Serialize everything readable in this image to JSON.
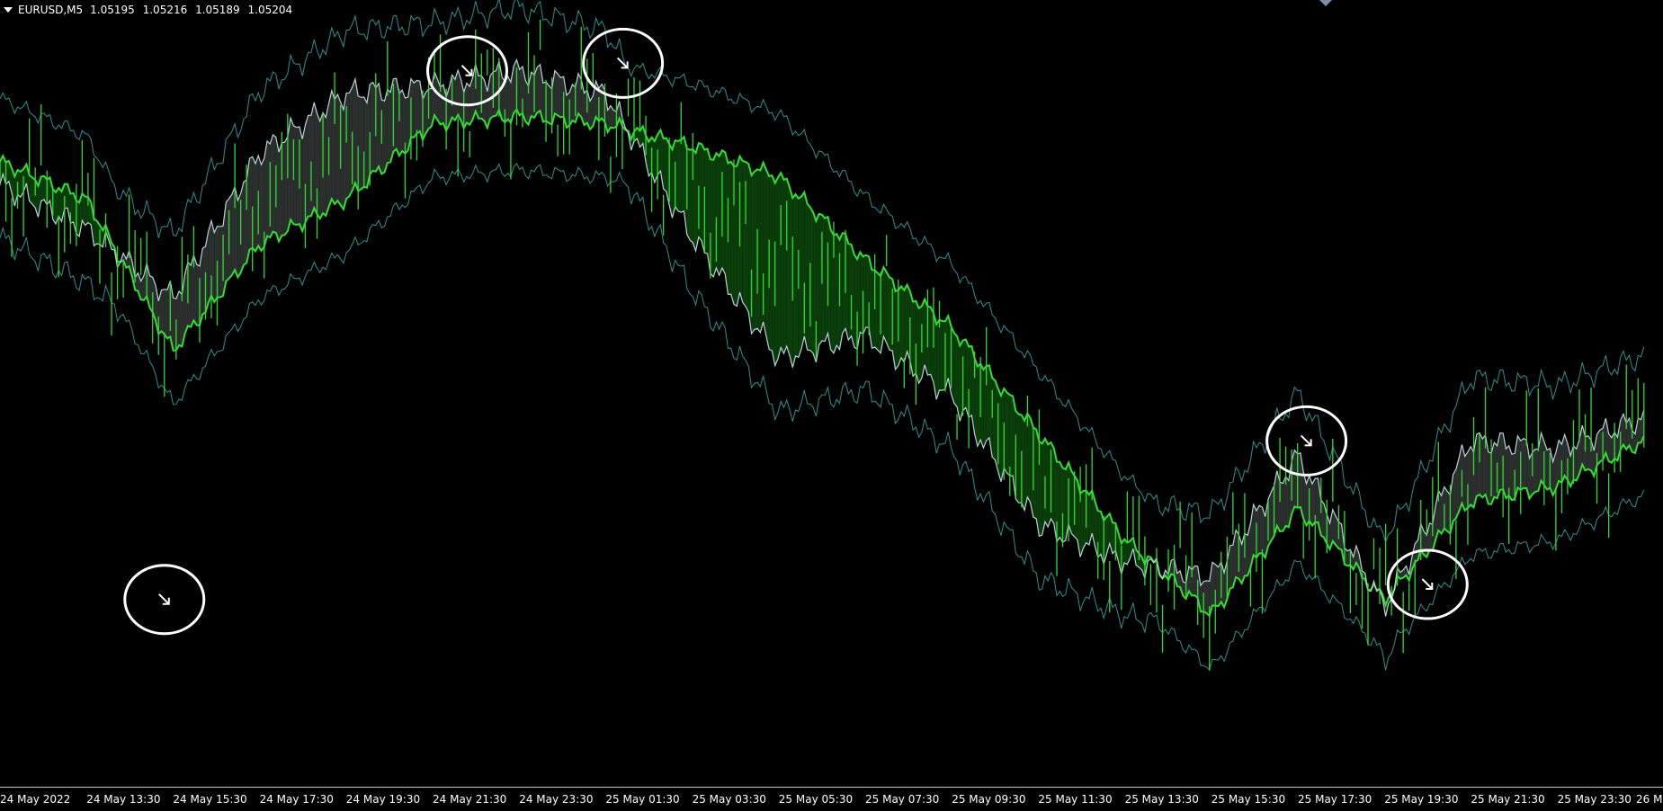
{
  "window": {
    "symbol": "EURUSD,M5",
    "ohlc": [
      "1.05195",
      "1.05216",
      "1.05189",
      "1.05204"
    ]
  },
  "colors": {
    "background": "#000000",
    "candle": "#32d932",
    "bullish_cloud": "#0a3d0a",
    "bullish_edge": "#33dd33",
    "bearish_cloud": "#2b2f2d",
    "bearish_edge": "#b9d4d8",
    "bollinger": "#2f8f8f",
    "marker": "#ffffff"
  },
  "time_axis": {
    "labels": [
      "24 May 2022",
      "24 May 13:30",
      "24 May 15:30",
      "24 May 17:30",
      "24 May 19:30",
      "24 May 21:30",
      "24 May 23:30",
      "25 May 01:30",
      "25 May 03:30",
      "25 May 05:30",
      "25 May 07:30",
      "25 May 09:30",
      "25 May 11:30",
      "25 May 13:30",
      "25 May 15:30",
      "25 May 17:30",
      "25 May 19:30",
      "25 May 21:30",
      "25 May 23:30",
      "26 M"
    ]
  },
  "chart_data": {
    "type": "line",
    "symbol": "EURUSD",
    "timeframe": "M5",
    "x_ticks": [
      "24 May 2022",
      "24 May 13:30",
      "24 May 15:30",
      "24 May 17:30",
      "24 May 19:30",
      "24 May 21:30",
      "24 May 23:30",
      "25 May 01:30",
      "25 May 03:30",
      "25 May 05:30",
      "25 May 07:30",
      "25 May 09:30",
      "25 May 11:30",
      "25 May 13:30",
      "25 May 15:30",
      "25 May 17:30",
      "25 May 19:30",
      "25 May 21:30",
      "25 May 23:30",
      "26 M"
    ],
    "x": [
      0,
      1,
      2,
      3,
      4,
      5,
      6,
      7,
      8,
      9,
      10,
      11,
      12,
      13,
      14,
      15,
      16,
      17,
      18,
      19
    ],
    "series": [
      {
        "values": [
          0.78,
          0.72,
          0.63,
          0.82,
          0.9,
          0.91,
          0.93,
          0.9,
          0.71,
          0.55,
          0.58,
          0.5,
          0.33,
          0.28,
          0.26,
          0.42,
          0.22,
          0.44,
          0.43,
          0.47
        ]
      },
      {
        "values": [
          0.81,
          0.76,
          0.56,
          0.7,
          0.76,
          0.86,
          0.87,
          0.86,
          0.83,
          0.79,
          0.68,
          0.59,
          0.45,
          0.31,
          0.21,
          0.35,
          0.23,
          0.36,
          0.38,
          0.44
        ]
      },
      {
        "values": [
          0.64,
          0.66,
          0.57,
          0.43,
          0.34,
          0.23,
          0.23,
          0.25,
          0.51,
          0.53,
          0.58,
          0.74,
          0.74,
          0.77,
          0.72,
          0.81,
          0.63,
          0.65,
          0.6,
          0.63
        ]
      }
    ],
    "annotations": [
      {
        "type": "circle-marker",
        "x": 1.9,
        "y": 0.23
      },
      {
        "type": "circle-marker",
        "x": 5.4,
        "y": 0.93
      },
      {
        "type": "circle-marker",
        "x": 7.2,
        "y": 0.94
      },
      {
        "type": "circle-marker",
        "x": 15.1,
        "y": 0.44
      },
      {
        "type": "circle-marker",
        "x": 16.5,
        "y": 0.25
      }
    ],
    "grid": false
  }
}
